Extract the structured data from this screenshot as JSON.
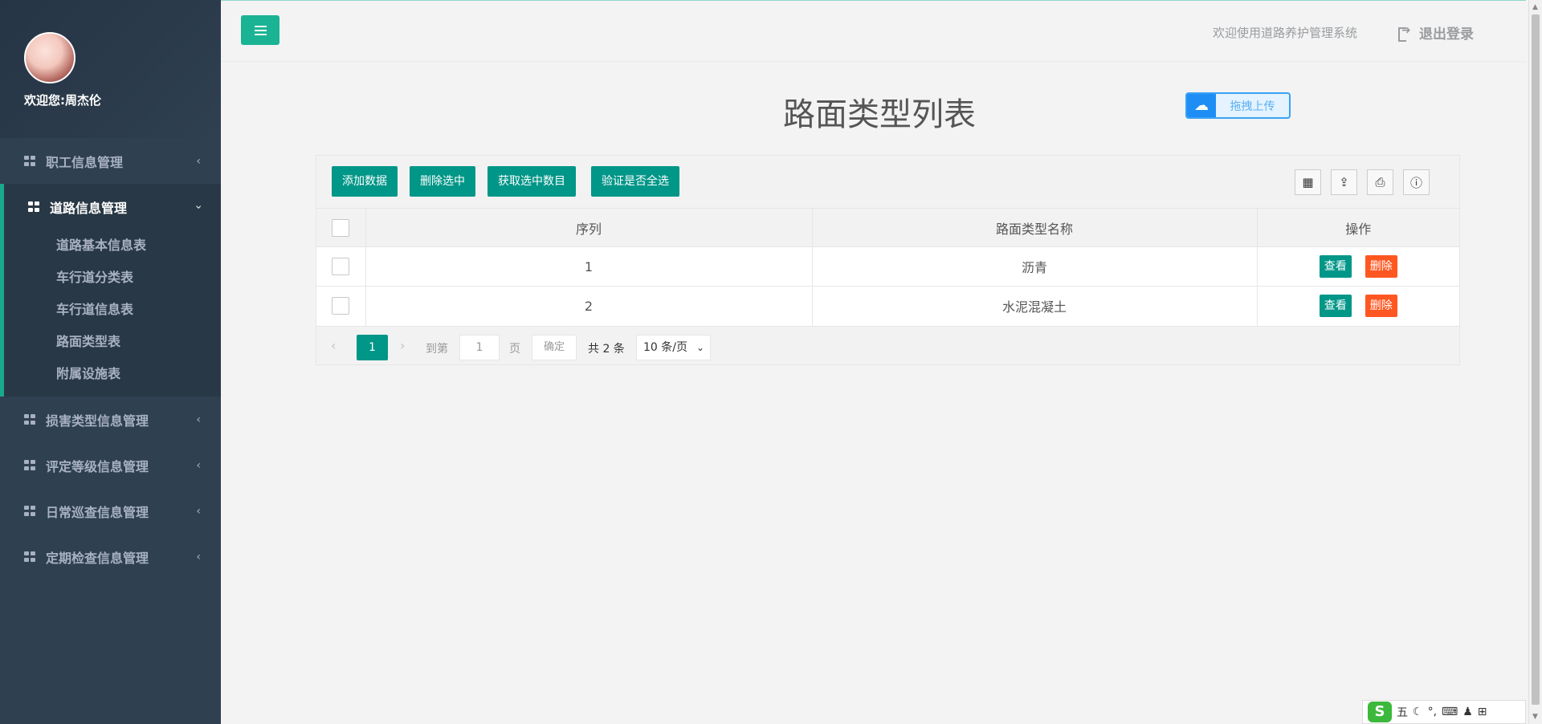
{
  "sidebar": {
    "welcome": "欢迎您:周杰伦",
    "menus": [
      {
        "label": "职工信息管理",
        "chevron": "‹"
      },
      {
        "label": "道路信息管理",
        "chevron": "›",
        "expanded": true,
        "children": [
          "道路基本信息表",
          "车行道分类表",
          "车行道信息表",
          "路面类型表",
          "附属设施表"
        ]
      },
      {
        "label": "损害类型信息管理",
        "chevron": "‹"
      },
      {
        "label": "评定等级信息管理",
        "chevron": "‹"
      },
      {
        "label": "日常巡查信息管理",
        "chevron": "‹"
      },
      {
        "label": "定期检查信息管理",
        "chevron": "‹"
      }
    ]
  },
  "header": {
    "welcome_text": "欢迎使用道路养护管理系统",
    "logout_label": "退出登录"
  },
  "page": {
    "title": "路面类型列表",
    "upload_label": "拖拽上传"
  },
  "toolbar": {
    "buttons": [
      "添加数据",
      "删除选中",
      "获取选中数目",
      "验证是否全选"
    ]
  },
  "table": {
    "columns": [
      "序列",
      "路面类型名称",
      "操作"
    ],
    "rows": [
      {
        "seq": "1",
        "name": "沥青"
      },
      {
        "seq": "2",
        "name": "水泥混凝土"
      }
    ],
    "view_label": "查看",
    "delete_label": "删除"
  },
  "pager": {
    "current_page": "1",
    "goto_label": "到第",
    "goto_value": "1",
    "page_label": "页",
    "confirm_label": "确定",
    "total": "共 2 条",
    "page_size": "10 条/页"
  },
  "tray": {
    "logo": "S",
    "ime_label": "五"
  },
  "colors": {
    "sidebar_bg": "#2f4050",
    "accent": "#1ab394",
    "button": "#009688",
    "danger": "#ff5722"
  }
}
